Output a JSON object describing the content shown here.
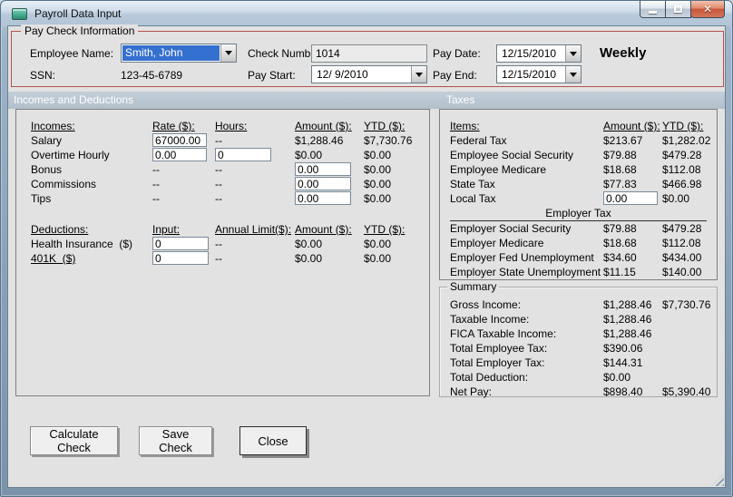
{
  "window": {
    "title": "Payroll Data Input"
  },
  "paycheck": {
    "group_label": "Pay Check Information",
    "employee_name_label": "Employee Name:",
    "employee_name_value": "Smith, John",
    "ssn_label": "SSN:",
    "ssn_value": "123-45-6789",
    "check_number_label": "Check Number:",
    "check_number_value": "1014",
    "pay_start_label": "Pay Start:",
    "pay_start_value": "12/ 9/2010",
    "pay_date_label": "Pay Date:",
    "pay_date_value": "12/15/2010",
    "pay_end_label": "Pay End:",
    "pay_end_value": "12/15/2010",
    "frequency": "Weekly"
  },
  "section_headers": {
    "left": "Incomes and Deductions",
    "right": "Taxes"
  },
  "incomes": {
    "headers": {
      "name": "Incomes:",
      "rate": "Rate ($):",
      "hours": "Hours:",
      "amount": "Amount ($):",
      "ytd": "YTD ($):"
    },
    "rows": [
      {
        "name": "Salary",
        "rate": "67000.00",
        "hours": "--",
        "amount": "$1,288.46",
        "ytd": "$7,730.76"
      },
      {
        "name": "Overtime Hourly",
        "rate": "0.00",
        "hours": "0",
        "amount": "$0.00",
        "ytd": "$0.00"
      },
      {
        "name": "Bonus",
        "rate": "--",
        "hours": "--",
        "amount": "0.00",
        "ytd": "$0.00"
      },
      {
        "name": "Commissions",
        "rate": "--",
        "hours": "--",
        "amount": "0.00",
        "ytd": "$0.00"
      },
      {
        "name": "Tips",
        "rate": "--",
        "hours": "--",
        "amount": "0.00",
        "ytd": "$0.00"
      }
    ]
  },
  "deductions": {
    "headers": {
      "name": "Deductions:",
      "input": "Input:",
      "limit": "Annual Limit($):",
      "amount": "Amount ($):",
      "ytd": "YTD ($):"
    },
    "rows": [
      {
        "name": "Health Insurance  ($)",
        "input": "0",
        "limit": "--",
        "amount": "$0.00",
        "ytd": "$0.00"
      },
      {
        "name": "401K  ($)",
        "input": "0",
        "limit": "--",
        "amount": "$0.00",
        "ytd": "$0.00"
      }
    ]
  },
  "taxes": {
    "headers": {
      "item": "Items:",
      "amount": "Amount ($):",
      "ytd": "YTD ($):"
    },
    "employee_rows": [
      {
        "item": "Federal Tax",
        "amount": "$213.67",
        "ytd": "$1,282.02"
      },
      {
        "item": "Employee Social Security",
        "amount": "$79.88",
        "ytd": "$479.28"
      },
      {
        "item": "Employee Medicare",
        "amount": "$18.68",
        "ytd": "$112.08"
      },
      {
        "item": "State Tax",
        "amount": "$77.83",
        "ytd": "$466.98"
      }
    ],
    "local_tax": {
      "item": "Local Tax",
      "amount": "0.00",
      "ytd": "$0.00"
    },
    "employer_divider": "Employer Tax",
    "employer_rows": [
      {
        "item": "Employer Social Security",
        "amount": "$79.88",
        "ytd": "$479.28"
      },
      {
        "item": "Employer Medicare",
        "amount": "$18.68",
        "ytd": "$112.08"
      },
      {
        "item": "Employer Fed Unemployment",
        "amount": "$34.60",
        "ytd": "$434.00"
      },
      {
        "item": "Employer State Unemployment",
        "amount": "$11.15",
        "ytd": "$140.00"
      }
    ]
  },
  "summary": {
    "group_label": "Summary",
    "rows": [
      {
        "label": "Gross Income:",
        "amount": "$1,288.46",
        "ytd": "$7,730.76"
      },
      {
        "label": "Taxable Income:",
        "amount": "$1,288.46",
        "ytd": ""
      },
      {
        "label": "FICA Taxable Income:",
        "amount": "$1,288.46",
        "ytd": ""
      },
      {
        "label": "Total Employee Tax:",
        "amount": "$390.06",
        "ytd": ""
      },
      {
        "label": "Total Employer Tax:",
        "amount": "$144.31",
        "ytd": ""
      },
      {
        "label": "Total Deduction:",
        "amount": "$0.00",
        "ytd": ""
      },
      {
        "label": "Net Pay:",
        "amount": "$898.40",
        "ytd": "$5,390.40"
      }
    ]
  },
  "buttons": {
    "calculate": "Calculate Check",
    "save": "Save Check",
    "close": "Close"
  }
}
